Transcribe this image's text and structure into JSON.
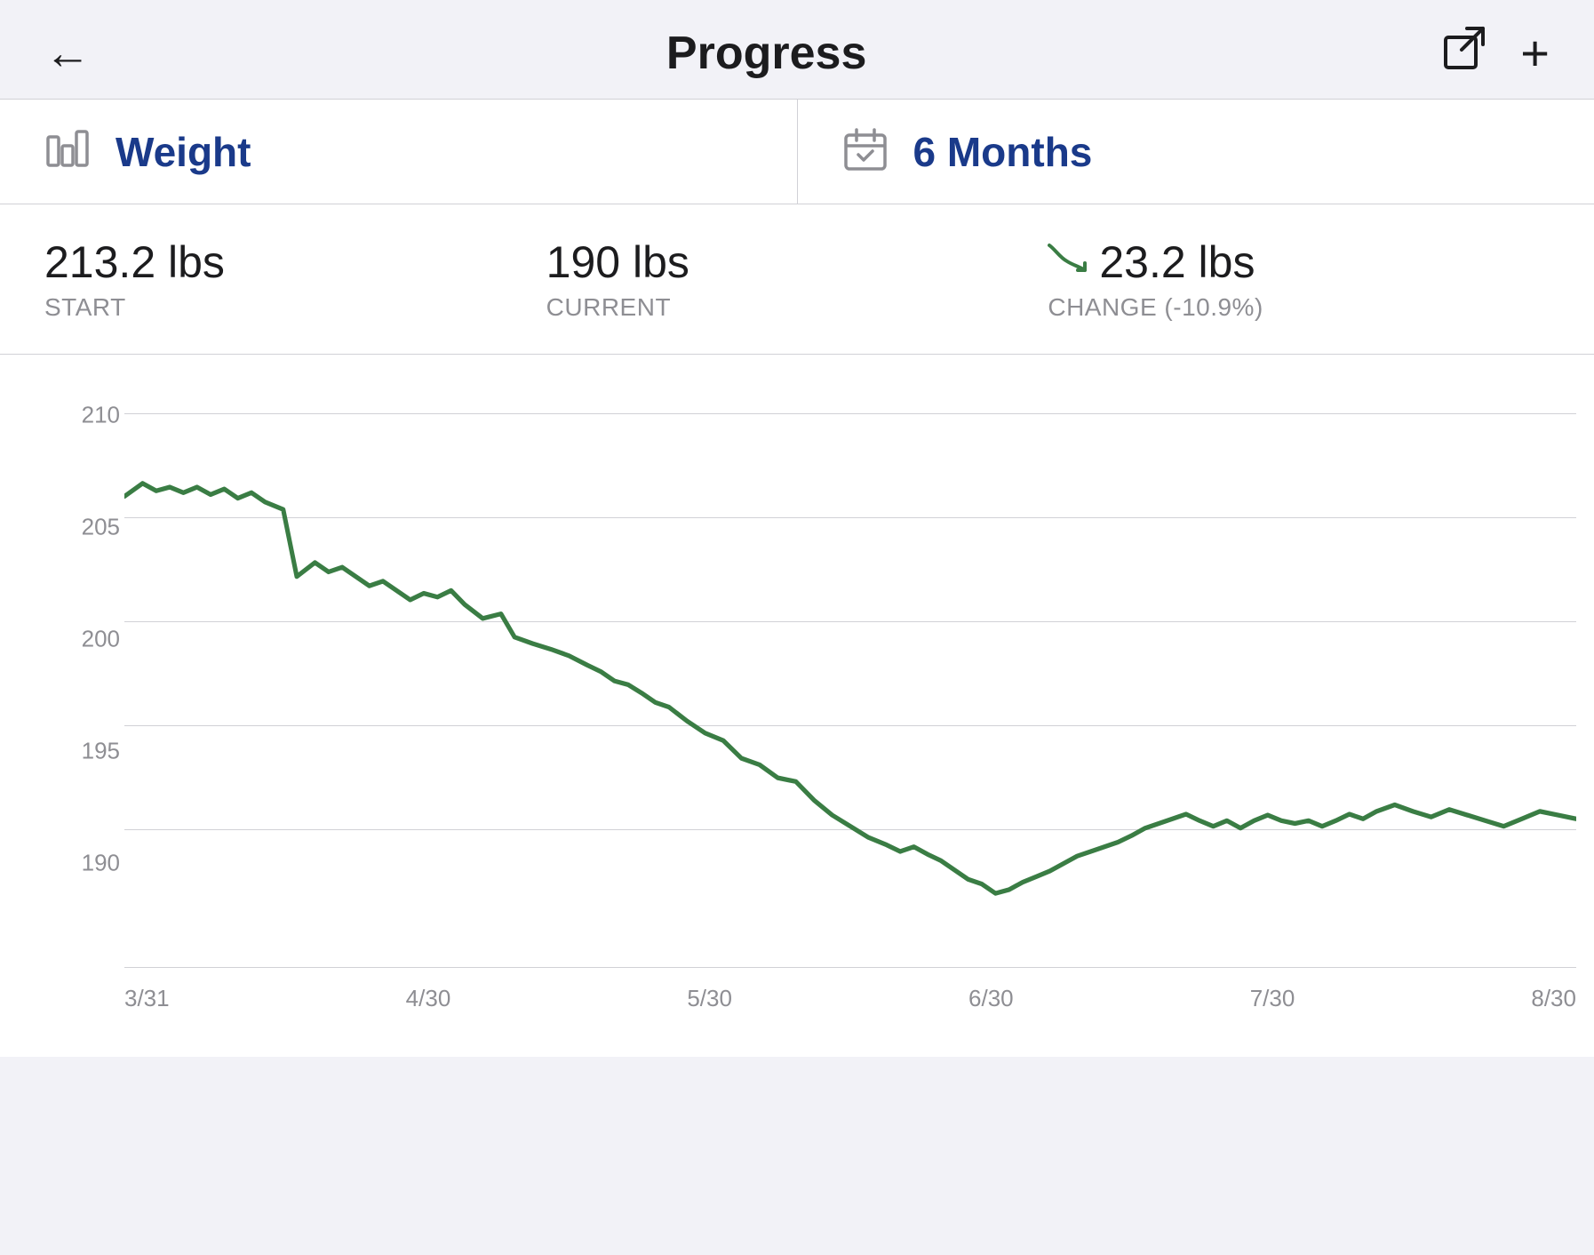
{
  "header": {
    "title": "Progress",
    "back_label": "←",
    "export_icon": "export-icon",
    "add_icon": "+"
  },
  "selector": {
    "weight_icon": "bar-chart-icon",
    "weight_label": "Weight",
    "calendar_icon": "calendar-icon",
    "period_label": "6 Months"
  },
  "stats": {
    "start_value": "213.2 lbs",
    "start_label": "START",
    "current_value": "190 lbs",
    "current_label": "CURRENT",
    "change_value": "23.2 lbs",
    "change_label": "CHANGE (-10.9%)"
  },
  "chart": {
    "y_labels": [
      "210",
      "205",
      "200",
      "195",
      "190"
    ],
    "x_labels": [
      "3/31",
      "4/30",
      "5/30",
      "6/30",
      "7/30",
      "8/30"
    ],
    "line_color": "#3a7d44",
    "accent_color": "#1a3a8a"
  }
}
